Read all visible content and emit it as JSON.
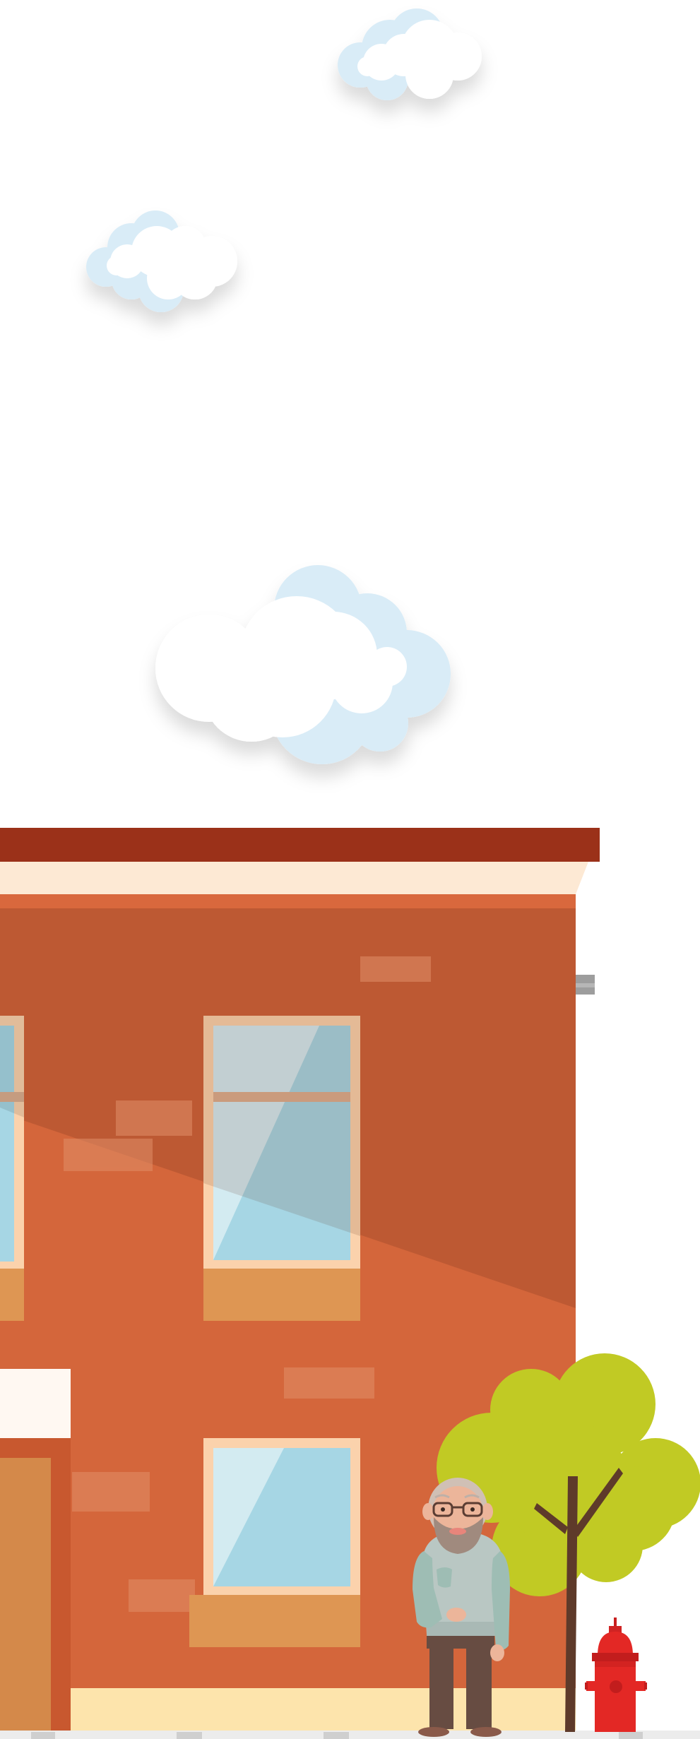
{
  "scene": {
    "kind": "street-illustration",
    "palette": {
      "sky": "#ffffff",
      "cloud_front": "#ffffff",
      "cloud_back": "#d9ecf7",
      "roof_trim": "#9b3119",
      "cornice": "#fde9d4",
      "brick_wall": "#d4663b",
      "wall_shadow": "#bd5933",
      "window_frame": "#fbd2ac",
      "window_glass": "#a6d6e4",
      "window_box": "#de9653",
      "door": "#d4894a",
      "sidewalk": "#fde4ac",
      "tree_foliage": "#c1ca24",
      "tree_trunk": "#5e3a2a",
      "hydrant": "#e32825",
      "person_sweater": "#9ebdb4",
      "person_pants": "#674c42"
    },
    "elements": {
      "clouds": [
        "cloud-1",
        "cloud-2",
        "cloud-3"
      ],
      "building": [
        "roof-trim",
        "cornice",
        "brick-wall",
        "windows",
        "door"
      ],
      "street": [
        "sidewalk",
        "tree",
        "fire-hydrant",
        "old-man-character"
      ]
    }
  }
}
